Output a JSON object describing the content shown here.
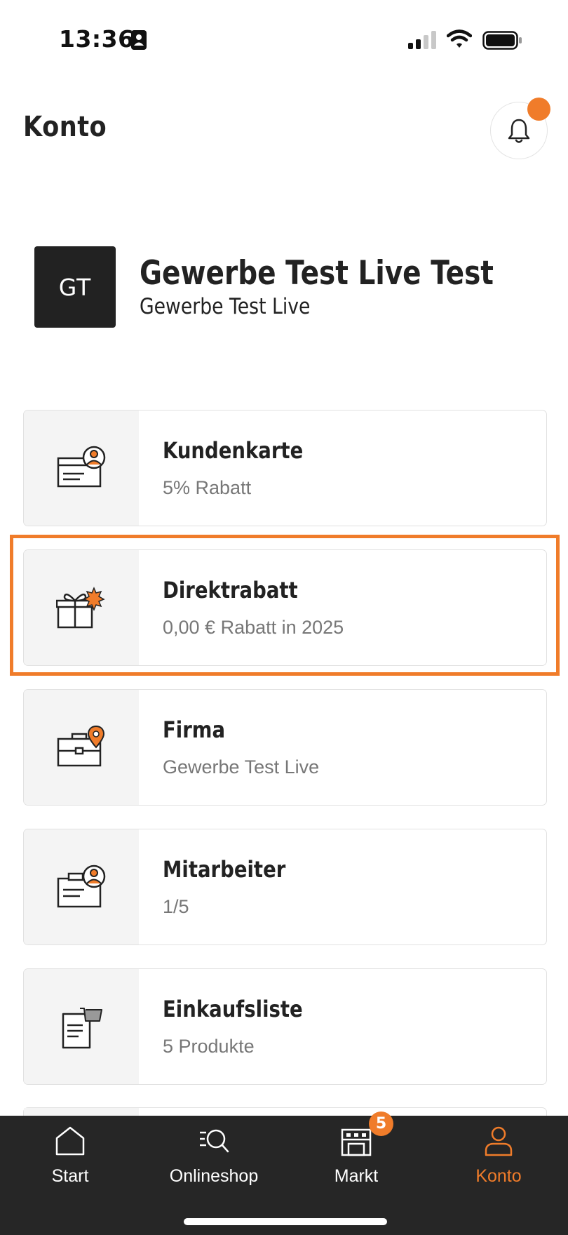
{
  "status_bar": {
    "time": "13:36",
    "icons": [
      "id-card-icon",
      "cellular-signal-icon",
      "wifi-icon",
      "battery-icon"
    ]
  },
  "header": {
    "title": "Konto",
    "notification_icon": "bell-icon",
    "notification_dot": true
  },
  "profile": {
    "initials": "GT",
    "name": "Gewerbe Test Live Test",
    "company": "Gewerbe Test Live"
  },
  "cards": [
    {
      "title": "Kundenkarte",
      "subtitle": "5% Rabatt",
      "icon": "customer-card-icon"
    },
    {
      "title": "Direktrabatt",
      "subtitle": "0,00 € Rabatt in 2025",
      "icon": "gift-discount-icon",
      "highlighted": true
    },
    {
      "title": "Firma",
      "subtitle": "Gewerbe Test Live",
      "icon": "briefcase-location-icon"
    },
    {
      "title": "Mitarbeiter",
      "subtitle": "1/5",
      "icon": "employee-card-icon"
    },
    {
      "title": "Einkaufsliste",
      "subtitle": "5 Produkte",
      "icon": "shopping-list-icon"
    }
  ],
  "bottom_nav": {
    "items": [
      {
        "label": "Start",
        "icon": "home-icon",
        "active": false
      },
      {
        "label": "Onlineshop",
        "icon": "search-list-icon",
        "active": false
      },
      {
        "label": "Markt",
        "icon": "store-icon",
        "active": false,
        "badge": "5"
      },
      {
        "label": "Konto",
        "icon": "user-icon",
        "active": true
      }
    ]
  },
  "colors": {
    "accent": "#f07c2a",
    "dark": "#262626",
    "text": "#222222",
    "subtext": "#777777",
    "icon_box": "#f4f4f4"
  }
}
